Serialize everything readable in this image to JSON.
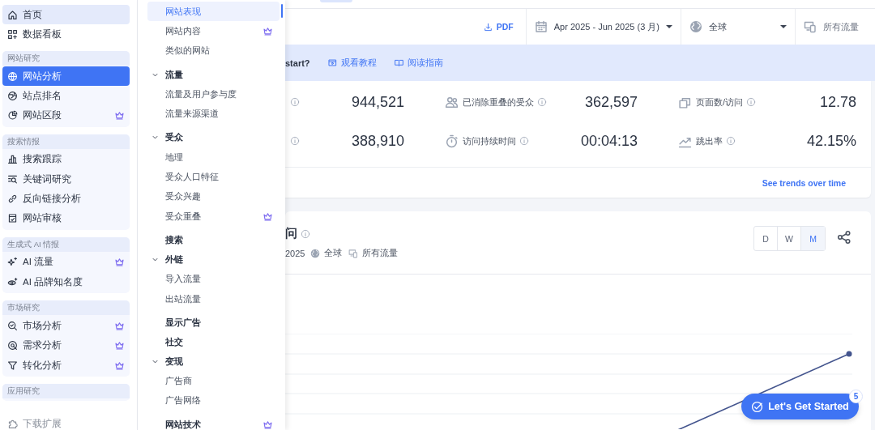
{
  "sidebar": {
    "top_items": [
      {
        "label": "首页",
        "selected": true,
        "premium": false
      },
      {
        "label": "数据看板",
        "selected": false,
        "premium": false
      }
    ],
    "groups": [
      {
        "title": "网站研究",
        "items": [
          {
            "label": "网站分析",
            "selected": true,
            "premium": false
          },
          {
            "label": "站点排名",
            "selected": false,
            "premium": false
          },
          {
            "label": "网站区段",
            "selected": false,
            "premium": true
          }
        ]
      },
      {
        "title": "搜索情报",
        "items": [
          {
            "label": "搜索跟踪",
            "selected": false,
            "premium": false
          },
          {
            "label": "关键词研究",
            "selected": false,
            "premium": false
          },
          {
            "label": "反向链接分析",
            "selected": false,
            "premium": false
          },
          {
            "label": "网站审核",
            "selected": false,
            "premium": false
          }
        ]
      },
      {
        "title": "生成式 AI 情报",
        "items": [
          {
            "label": "AI 流量",
            "selected": false,
            "premium": true
          },
          {
            "label": "AI 品牌知名度",
            "selected": false,
            "premium": false
          }
        ]
      },
      {
        "title": "市场研究",
        "items": [
          {
            "label": "市场分析",
            "selected": false,
            "premium": true
          },
          {
            "label": "需求分析",
            "selected": false,
            "premium": true
          },
          {
            "label": "转化分析",
            "selected": false,
            "premium": true
          }
        ]
      },
      {
        "title": "应用研究"
      }
    ],
    "footer": "下载扩展"
  },
  "submenu": [
    {
      "kind": "item",
      "label": "网站表现",
      "selected": true,
      "premium": false
    },
    {
      "kind": "item",
      "label": "网站内容",
      "selected": false,
      "premium": true
    },
    {
      "kind": "item",
      "label": "类似的网站",
      "selected": false,
      "premium": false
    },
    {
      "kind": "section",
      "label": "流量",
      "expanded": true,
      "premium": false,
      "children": [
        {
          "label": "流量及用户参与度",
          "selected": false,
          "premium": false
        },
        {
          "label": "流量来源渠道",
          "selected": false,
          "premium": false
        }
      ]
    },
    {
      "kind": "section",
      "label": "受众",
      "expanded": true,
      "premium": false,
      "children": [
        {
          "label": "地理",
          "selected": false,
          "premium": false
        },
        {
          "label": "受众人口特征",
          "selected": false,
          "premium": false
        },
        {
          "label": "受众兴趣",
          "selected": false,
          "premium": false
        },
        {
          "label": "受众重叠",
          "selected": false,
          "premium": true
        }
      ]
    },
    {
      "kind": "section",
      "label": "搜索",
      "premium": false
    },
    {
      "kind": "section",
      "label": "外链",
      "expanded": true,
      "premium": false,
      "children": [
        {
          "label": "导入流量",
          "selected": false,
          "premium": false
        },
        {
          "label": "出站流量",
          "selected": false,
          "premium": false
        }
      ]
    },
    {
      "kind": "section",
      "label": "显示广告",
      "premium": false
    },
    {
      "kind": "section",
      "label": "社交",
      "premium": false
    },
    {
      "kind": "section",
      "label": "变现",
      "expanded": true,
      "premium": false,
      "children": [
        {
          "label": "广告商",
          "selected": false,
          "premium": false
        },
        {
          "label": "广告网络",
          "selected": false,
          "premium": false
        }
      ]
    },
    {
      "kind": "section",
      "label": "网站技术",
      "premium": true
    }
  ],
  "toolbar": {
    "pdf": "PDF",
    "date_range": "Apr 2025 - Jun 2025 (3 月)",
    "region": "全球",
    "traffic": "所有流量"
  },
  "banner": {
    "text": "start?",
    "links": [
      "观看教程",
      "阅读指南"
    ]
  },
  "metrics": [
    {
      "value": "944,521"
    },
    {
      "label": "已消除重叠的受众",
      "value": "362,597"
    },
    {
      "label": "页面数/访问",
      "value": "12.78"
    },
    {
      "value": "388,910"
    },
    {
      "label": "访问持续时间",
      "value": "00:04:13"
    },
    {
      "label": "跳出率",
      "value": "42.15%"
    }
  ],
  "trends_link": "See trends over time",
  "chart_card": {
    "title": "问",
    "subtitle": {
      "date": "2025",
      "region": "全球",
      "traffic": "所有流量"
    },
    "granularity": [
      {
        "label": "D",
        "selected": false
      },
      {
        "label": "W",
        "selected": false
      },
      {
        "label": "M",
        "selected": true
      }
    ]
  },
  "cta": {
    "label": "Let's Get Started",
    "badge": "5"
  }
}
